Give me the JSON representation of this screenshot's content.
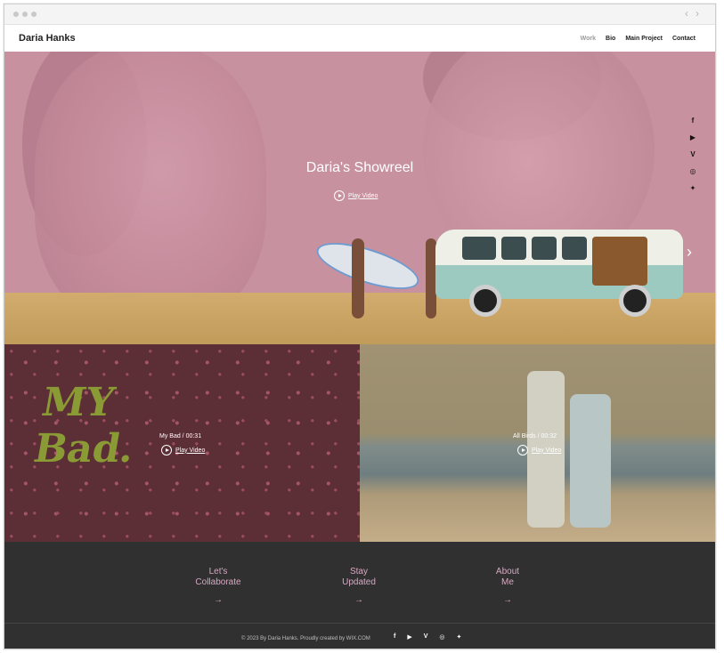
{
  "site": {
    "title": "Daria Hanks"
  },
  "nav": {
    "items": [
      "Work",
      "Bio",
      "Main Project",
      "Contact"
    ]
  },
  "hero": {
    "title": "Daria's Showreel",
    "play_label": "Play Video"
  },
  "social_icons": [
    "facebook-icon",
    "youtube-icon",
    "vimeo-icon",
    "instagram-icon",
    "twitter-icon"
  ],
  "social_glyphs": {
    "facebook": "f",
    "youtube": "▶",
    "vimeo": "V",
    "instagram": "◎",
    "twitter": "✦"
  },
  "tiles": [
    {
      "artwork_text": [
        "MY",
        "Bad."
      ],
      "label": "My Bad / 00:31",
      "play_label": "Play Video"
    },
    {
      "label": "All Birds / 00:32",
      "play_label": "Play Video"
    }
  ],
  "footer": {
    "links": [
      {
        "line1": "Let's",
        "line2": "Collaborate"
      },
      {
        "line1": "Stay",
        "line2": "Updated"
      },
      {
        "line1": "About",
        "line2": "Me"
      }
    ],
    "copyright": "© 2023 By Daria Hanks. Proudly created by WIX.COM"
  },
  "colors": {
    "hero_pink": "#c7919f",
    "footer_bg": "#303030",
    "footer_link": "#d7a8c2",
    "mybad_green": "#8a9a35"
  }
}
